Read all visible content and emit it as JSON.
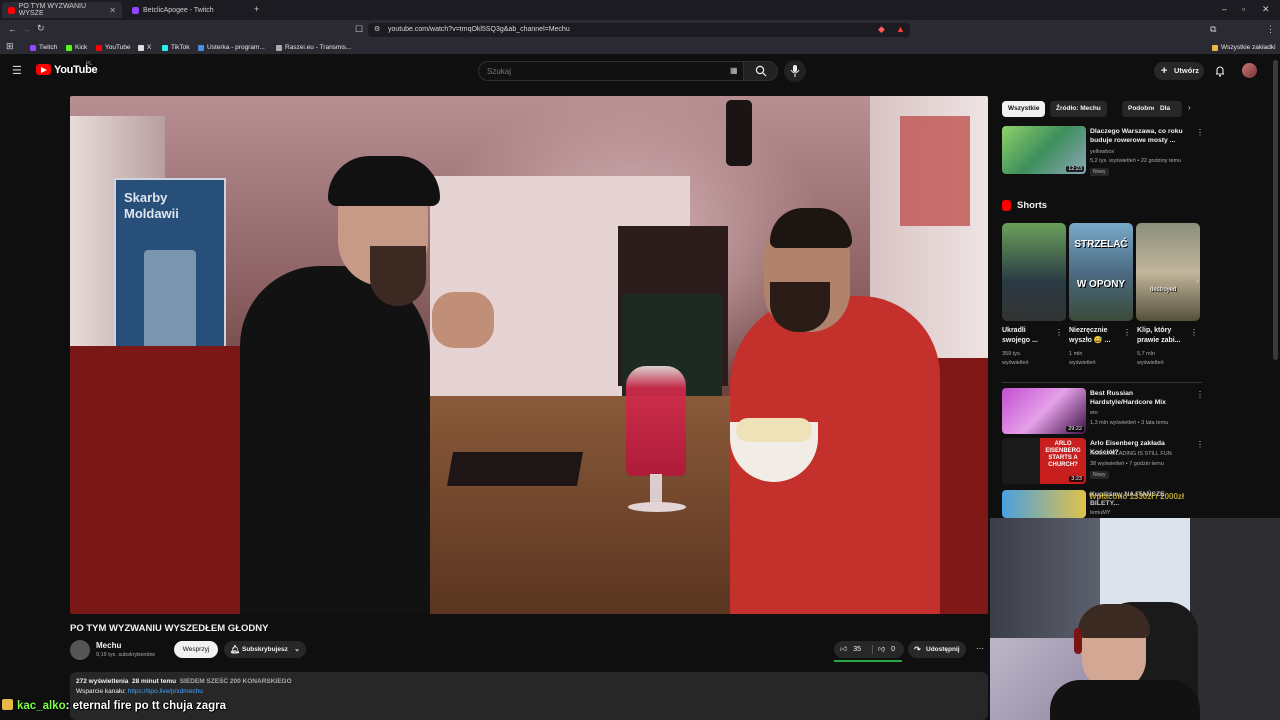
{
  "browser": {
    "tabs": [
      {
        "label": "PO TYM WYZWANIU WYSZE",
        "active": true
      },
      {
        "label": "BetclicApogee - Twitch",
        "active": false
      }
    ],
    "url": "youtube.com/watch?v=tmqOkl5SQ3g&ab_channel=Mechu",
    "bookmarks": [
      "Twitch",
      "Kick",
      "YouTube",
      "X",
      "TikTok",
      "Usterka - program...",
      "Raszei.eu - Transmis..."
    ],
    "all_bookmarks": "Wszystkie zakładki"
  },
  "masthead": {
    "logo_text": "YouTube",
    "logo_region": "PL",
    "search_placeholder": "Szukaj",
    "create_label": "Utwórz"
  },
  "video": {
    "title": "PO TYM WYZWANIU WYSZEDŁEM GŁODNY",
    "scene_sign": "Skarby Moldawii",
    "channel": "Mechu",
    "subscribers": "9,19 tys. subskrybentów",
    "support_label": "Wesprzyj",
    "subscribed_label": "Subskrybujesz",
    "likes": "35",
    "dislikes": "0",
    "share_label": "Udostępnij",
    "views": "272 wyświetlenia",
    "time_ago": "28 minut temu",
    "tags": "SIEDEM SZEŚĆ 200 KONARSKIEGO",
    "support_text": "Wsparcie kanału:",
    "support_link": "https://tipo.live/p/xdmechu"
  },
  "sidebar": {
    "chips": [
      "Wszystkie",
      "Źródło: Mechu",
      "Podobne",
      "Dla"
    ],
    "top_video": {
      "title_line1": "Dlaczego Warszawa, co roku",
      "title_line2": "buduje rowerowe mosty ...",
      "channel": "yellowbox",
      "meta": "5,2 tys. wyświetleń • 22 godziny temu",
      "badge": "Nowy",
      "duration": "12:23"
    },
    "shorts_header": "Shorts",
    "shorts": [
      {
        "title1": "Ukradli",
        "title2": "swojego ...",
        "views1": "359 tys.",
        "views2": "wyświetleń",
        "overlay": ""
      },
      {
        "title1": "Niezręcznie",
        "title2": "wyszło 😅 ...",
        "views1": "1 mln",
        "views2": "wyświetleń",
        "overlay": "STRZELAĆ W OPONY"
      },
      {
        "title1": "Klip, który",
        "title2": "prawie zabi...",
        "views1": "5,7 mln",
        "views2": "wyświetleń",
        "overlay": "destroyed"
      }
    ],
    "videos": [
      {
        "title_line1": "Best Russian",
        "title_line2": "Hardstyle/Hardcore Mix",
        "channel": "eto",
        "meta": "1,3 mln wyświetleń • 3 lata temu",
        "badge": "",
        "duration": "29:22"
      },
      {
        "title_line1": "Arlo Eisenberg zakłada Kościół?",
        "title_line2": "",
        "channel": "ROLLERBLADING IS STILL FUN",
        "meta": "38 wyświetleń • 7 godzin temu",
        "badge": "Nowy",
        "duration": "3:23",
        "thumb_text": "ARLO EISENBERG STARTS A CHURCH?"
      },
      {
        "title_line1": "Kupiliśmy NAJTAŃSZE BILETY...",
        "title_line2": "",
        "channel": "temuMY",
        "meta": "",
        "badge": "",
        "duration": ""
      }
    ]
  },
  "overlay": {
    "chat_user": "kac_alko",
    "chat_message": ": eternal fire po tt chuja zagra",
    "donation": "Wpłacono 1330zł / 2000zł"
  },
  "colors": {
    "yt_red": "#ff0000",
    "like_green": "#2ba640",
    "chat_name": "#7cff4a"
  }
}
